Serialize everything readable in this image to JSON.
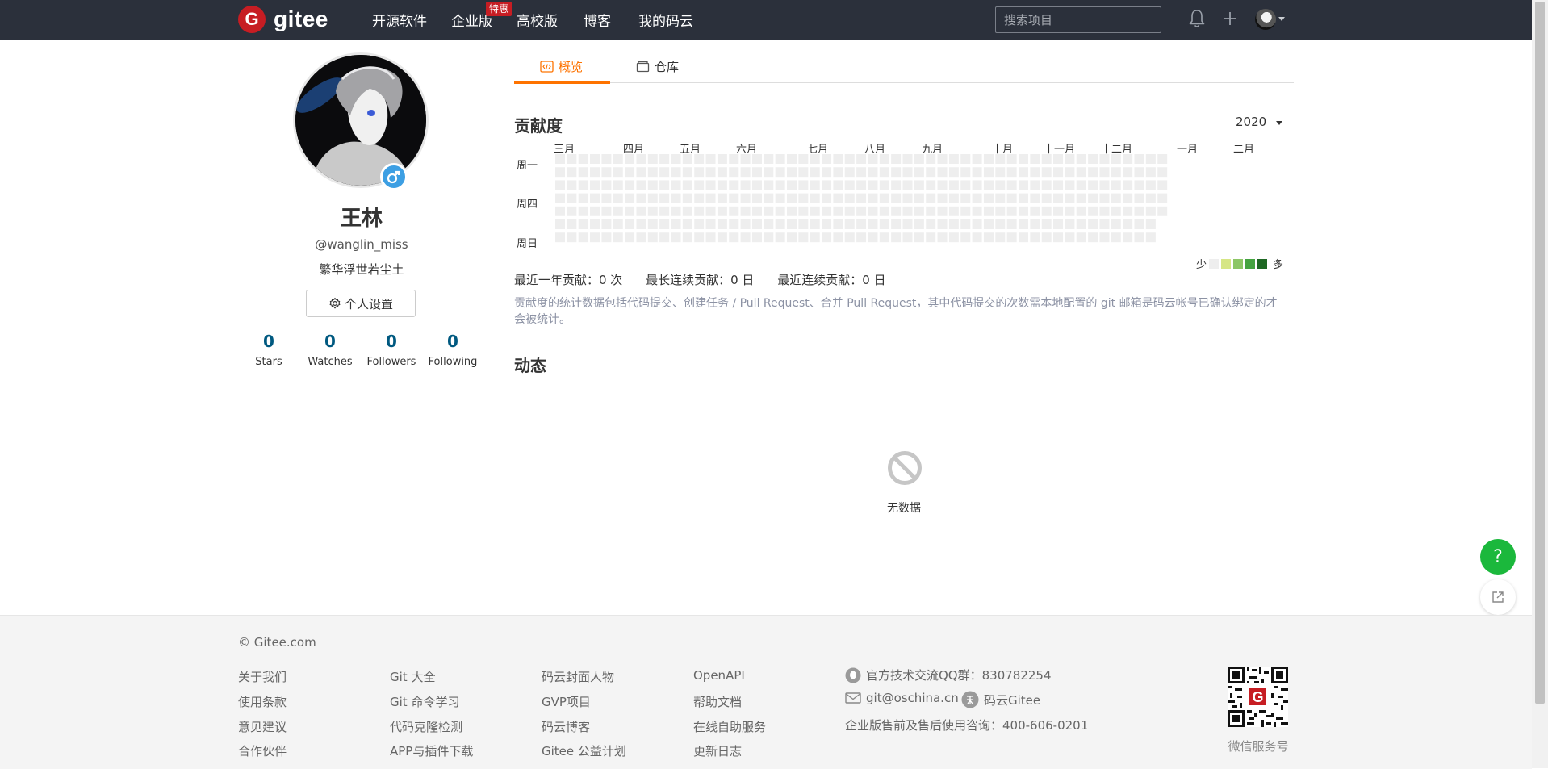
{
  "nav": {
    "logo_letter": "G",
    "logo_text": "gitee",
    "items": [
      "开源软件",
      "企业版",
      "高校版",
      "博客",
      "我的码云"
    ],
    "badge": "特惠",
    "search_placeholder": "搜索项目"
  },
  "profile": {
    "name": "王林",
    "handle": "@wanglin_miss",
    "bio": "繁华浮世若尘土",
    "settings_label": "个人设置",
    "stats": [
      {
        "value": "0",
        "label": "Stars"
      },
      {
        "value": "0",
        "label": "Watches"
      },
      {
        "value": "0",
        "label": "Followers"
      },
      {
        "value": "0",
        "label": "Following"
      }
    ]
  },
  "tabs": [
    "概览",
    "仓库"
  ],
  "contribution": {
    "title": "贡献度",
    "year": "2020",
    "months": [
      "三月",
      "四月",
      "五月",
      "六月",
      "七月",
      "八月",
      "九月",
      "十月",
      "十一月",
      "十二月",
      "一月",
      "二月"
    ],
    "weekdays": [
      "周一",
      "周四",
      "周日"
    ],
    "legend_less": "少",
    "legend_more": "多",
    "legend_colors": [
      "#eeeeee",
      "#d6e685",
      "#8cc665",
      "#44a340",
      "#1e6823"
    ],
    "empty_color": "#eeeeee",
    "summary": [
      "最近一年贡献：0 次",
      "最长连续贡献：0 日",
      "最近连续贡献：0 日"
    ],
    "note": "贡献度的统计数据包括代码提交、创建任务 / Pull Request、合并 Pull Request，其中代码提交的次数需本地配置的 git 邮箱是码云帐号已确认绑定的才会被统计。"
  },
  "activity": {
    "title": "动态",
    "empty_text": "无数据"
  },
  "floating": {
    "help": "?"
  },
  "footer": {
    "copyright": "© Gitee.com",
    "col1": [
      "关于我们",
      "使用条款",
      "意见建议",
      "合作伙伴"
    ],
    "col2": [
      "Git 大全",
      "Git 命令学习",
      "代码克隆检测",
      "APP与插件下载"
    ],
    "col3": [
      "码云封面人物",
      "GVP项目",
      "码云博客",
      "Gitee 公益计划"
    ],
    "col4": [
      "OpenAPI",
      "帮助文档",
      "在线自助服务",
      "更新日志"
    ],
    "qq": "官方技术交流QQ群：830782254",
    "email": "git@oschina.cn",
    "zhihu": "码云Gitee",
    "consult": "企业版售前及售后使用咨询：400-606-0201",
    "qr_label": "微信服务号"
  }
}
